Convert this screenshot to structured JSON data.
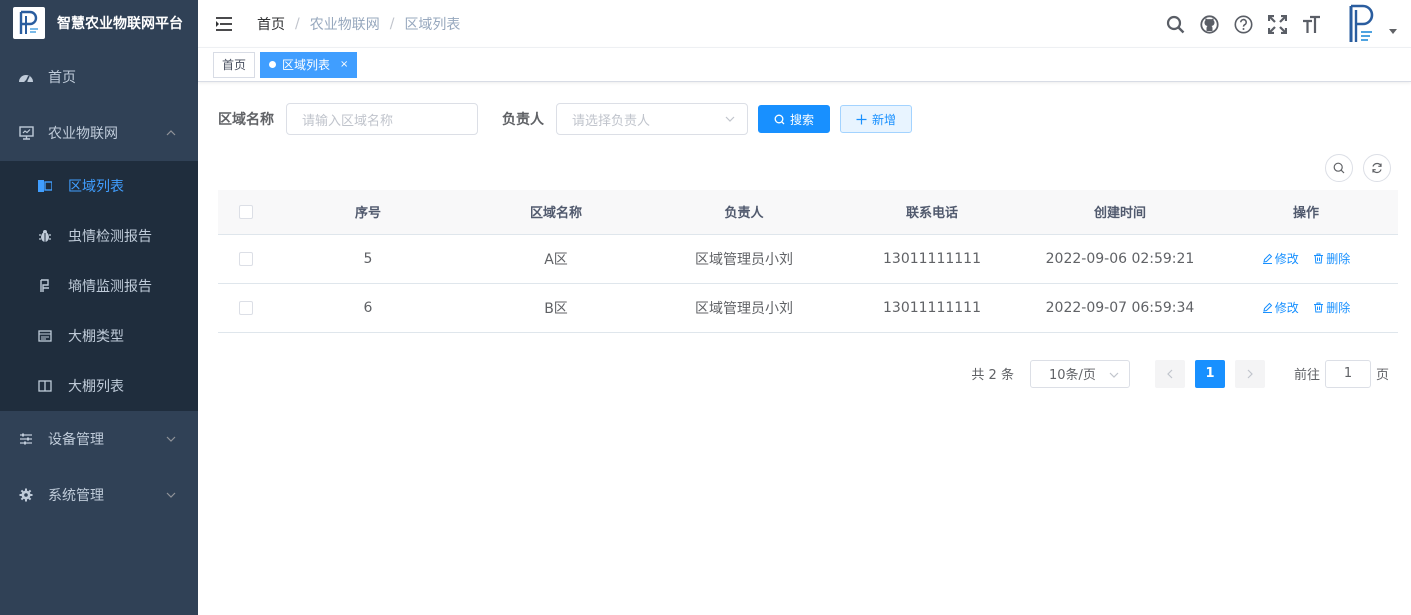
{
  "brand": {
    "title": "智慧农业物联网平台"
  },
  "sidebar": {
    "menu": [
      {
        "label": "首页",
        "icon": "dashboard-icon"
      },
      {
        "label": "农业物联网",
        "icon": "monitor-icon",
        "expanded": true,
        "children": [
          {
            "label": "区域列表",
            "icon": "region-icon",
            "active": true
          },
          {
            "label": "虫情检测报告",
            "icon": "bug-icon"
          },
          {
            "label": "墒情监测报告",
            "icon": "soil-icon"
          },
          {
            "label": "大棚类型",
            "icon": "greenhouse-type-icon"
          },
          {
            "label": "大棚列表",
            "icon": "greenhouse-list-icon"
          }
        ]
      },
      {
        "label": "设备管理",
        "icon": "sliders-icon"
      },
      {
        "label": "系统管理",
        "icon": "settings-icon"
      }
    ]
  },
  "breadcrumb": {
    "home": "首页",
    "level1": "农业物联网",
    "level2": "区域列表",
    "sep": "/"
  },
  "tags": {
    "home": "首页",
    "active": "区域列表",
    "close": "×"
  },
  "filter": {
    "name_label": "区域名称",
    "name_placeholder": "请输入区域名称",
    "owner_label": "负责人",
    "owner_placeholder": "请选择负责人",
    "search_btn": "搜索",
    "add_btn": "新增"
  },
  "table": {
    "headers": {
      "index": "序号",
      "name": "区域名称",
      "owner": "负责人",
      "phone": "联系电话",
      "created": "创建时间",
      "ops": "操作"
    },
    "rows": [
      {
        "index": "5",
        "name": "A区",
        "owner": "区域管理员小刘",
        "phone": "13011111111",
        "created": "2022-09-06 02:59:21",
        "edit": "修改",
        "delete": "删除"
      },
      {
        "index": "6",
        "name": "B区",
        "owner": "区域管理员小刘",
        "phone": "13011111111",
        "created": "2022-09-07 06:59:34",
        "edit": "修改",
        "delete": "删除"
      }
    ]
  },
  "pagination": {
    "total": "共 2 条",
    "page_size": "10条/页",
    "current": "1",
    "goto_label": "前往",
    "goto_value": "1",
    "page_unit": "页"
  },
  "colors": {
    "sidebar_bg": "#304156",
    "submenu_bg": "#1f2d3d",
    "accent": "#1890ff"
  }
}
